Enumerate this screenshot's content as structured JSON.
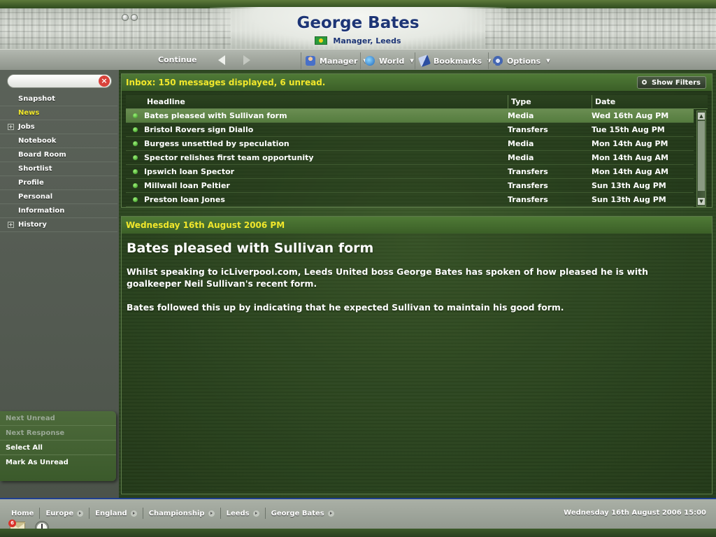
{
  "header": {
    "manager_name": "George Bates",
    "manager_sub": "Manager, Leeds",
    "flag_icon": "brazil-flag-icon"
  },
  "menubar": {
    "continue_label": "Continue",
    "back_icon": "left-arrow-icon",
    "forward_icon": "right-arrow-icon",
    "menus": [
      {
        "label": "Manager",
        "icon": "manager-icon"
      },
      {
        "label": "World",
        "icon": "globe-icon"
      },
      {
        "label": "Bookmarks",
        "icon": "bookmarks-icon"
      },
      {
        "label": "Options",
        "icon": "gear-icon"
      }
    ]
  },
  "sidebar": {
    "search": {
      "value": "",
      "placeholder": ""
    },
    "items": [
      {
        "label": "Snapshot",
        "active": false,
        "expandable": false
      },
      {
        "label": "News",
        "active": true,
        "expandable": false
      },
      {
        "label": "Jobs",
        "active": false,
        "expandable": true
      },
      {
        "label": "Notebook",
        "active": false,
        "expandable": false
      },
      {
        "label": "Board Room",
        "active": false,
        "expandable": false
      },
      {
        "label": "Shortlist",
        "active": false,
        "expandable": false
      },
      {
        "label": "Profile",
        "active": false,
        "expandable": false
      },
      {
        "label": "Personal",
        "active": false,
        "expandable": false
      },
      {
        "label": "Information",
        "active": false,
        "expandable": false
      },
      {
        "label": "History",
        "active": false,
        "expandable": true
      }
    ],
    "actions": [
      {
        "label": "Next Unread",
        "enabled": false
      },
      {
        "label": "Next Response",
        "enabled": false
      },
      {
        "label": "Select All",
        "enabled": true
      },
      {
        "label": "Mark As Unread",
        "enabled": true
      }
    ]
  },
  "inbox": {
    "title": "Inbox: 150 messages displayed, 6 unread.",
    "show_filters_label": "Show Filters",
    "columns": {
      "headline": "Headline",
      "type": "Type",
      "date": "Date"
    },
    "rows": [
      {
        "headline": "Bates pleased with Sullivan form",
        "type": "Media",
        "date": "Wed 16th Aug PM",
        "selected": true
      },
      {
        "headline": "Bristol Rovers sign Diallo",
        "type": "Transfers",
        "date": "Tue 15th Aug PM",
        "selected": false
      },
      {
        "headline": "Burgess unsettled by speculation",
        "type": "Media",
        "date": "Mon 14th Aug PM",
        "selected": false
      },
      {
        "headline": "Spector relishes first team opportunity",
        "type": "Media",
        "date": "Mon 14th Aug AM",
        "selected": false
      },
      {
        "headline": "Ipswich loan Spector",
        "type": "Transfers",
        "date": "Mon 14th Aug AM",
        "selected": false
      },
      {
        "headline": "Millwall loan Peltier",
        "type": "Transfers",
        "date": "Sun 13th Aug PM",
        "selected": false
      },
      {
        "headline": "Preston loan Jones",
        "type": "Transfers",
        "date": "Sun 13th Aug PM",
        "selected": false
      }
    ]
  },
  "article": {
    "date": "Wednesday 16th August 2006 PM",
    "headline": "Bates pleased with Sullivan form",
    "paragraphs": [
      "Whilst speaking to icLiverpool.com, Leeds United boss George Bates has spoken of how pleased he is with goalkeeper Neil Sullivan's recent form.",
      "Bates followed this up by indicating that he expected Sullivan to maintain his good form."
    ]
  },
  "footer": {
    "breadcrumbs": [
      "Home",
      "Europe",
      "England",
      "Championship",
      "Leeds",
      "George Bates"
    ],
    "game_date": "Wednesday 16th August 2006 15:00",
    "mail_badge": "6",
    "mail_icon": "mail-icon",
    "stopwatch_icon": "stopwatch-icon"
  },
  "colors": {
    "accent_yellow": "#f1e72b",
    "title_blue": "#1d3576",
    "panel_green": "#3b5f27"
  }
}
